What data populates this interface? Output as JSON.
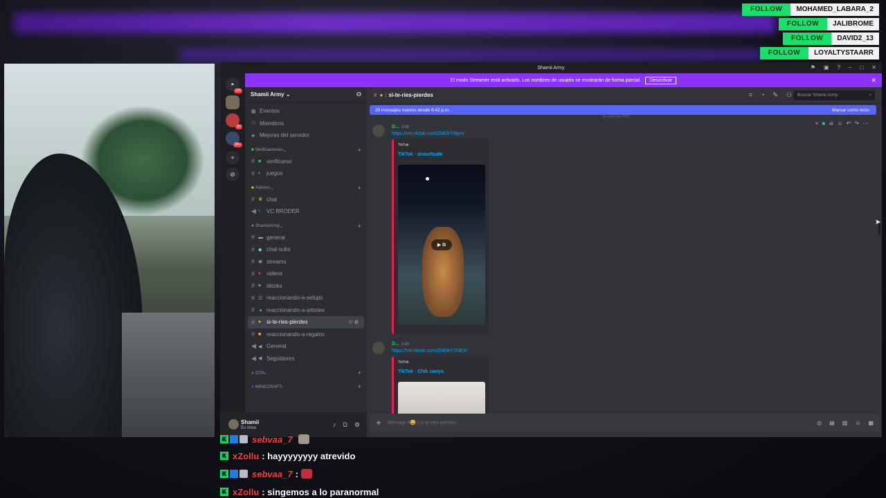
{
  "follow_alerts": [
    {
      "button": "FOLLOW",
      "name": "MOHAMED_LABARA_2"
    },
    {
      "button": "FOLLOW",
      "name": "JALIBROME"
    },
    {
      "button": "FOLLOW",
      "name": "DAVID2_13"
    },
    {
      "button": "FOLLOW",
      "name": "LOYALTYSTAARR"
    }
  ],
  "window": {
    "title": "Shamii Army"
  },
  "streamer_bar": {
    "text": "El modo Streamer está activado. Los nombres de usuario se mostrarán de forma parcial.",
    "button": "Desactivar"
  },
  "guild_badges": [
    "126",
    "32",
    "9K+"
  ],
  "server": {
    "name": "Shamii Army"
  },
  "top_items": [
    "Eventos",
    "Miembros",
    "Mejoras del servidor"
  ],
  "categories": {
    "verif": "Verificaciones",
    "admin": "Admins",
    "army": "ShamiiArmy",
    "gta": "GTA",
    "mc": "MINECRAFT"
  },
  "channels_verif": [
    "verificarse",
    "juegos"
  ],
  "channels_admin": [
    "chat",
    "VC BRODER"
  ],
  "channels_army": [
    "general",
    "chat-subs",
    "streams",
    "videos",
    "tiktoks",
    "reaccionando-a-setups",
    "reaccionando-a-arboles",
    "si-te-ries-pierdes",
    "reaccionando-a-regalos",
    "General",
    "Seguidores"
  ],
  "user": {
    "name": "Shamii",
    "status": "En línea"
  },
  "channel_header": {
    "name": "si-te-ries-pierdes",
    "search": "Buscar Shamii Army"
  },
  "new_messages": {
    "text": "20 mensajes nuevos desde 6:42 p.m.",
    "mark": "Marcar como leído"
  },
  "date_divider": "de enero de 2025",
  "messages": [
    {
      "author": "D...",
      "time": "2:09",
      "link": "https://vm.tiktok.com/ZMDkY6tpn/",
      "provider": "TikTok",
      "embed_title": "TikTok · aivaultsafe"
    },
    {
      "author": "D...",
      "time": "2:33",
      "link": "https://vm.tiktok.com/ZMDkY1NEX/",
      "provider": "TikTok",
      "embed_title": "TikTok · Chik zawya"
    }
  ],
  "composer": {
    "placeholder": "Mensaje #😄 | si-te-ries-pierdes"
  },
  "chat": [
    {
      "user": "sebvaa_7",
      "text": ""
    },
    {
      "user": "xZollu",
      "text": ": hayyyyyyyy atrevido"
    },
    {
      "user": "sebvaa_7",
      "text": ":"
    },
    {
      "user": "xZollu",
      "text": ": singemos a lo paranormal"
    }
  ]
}
